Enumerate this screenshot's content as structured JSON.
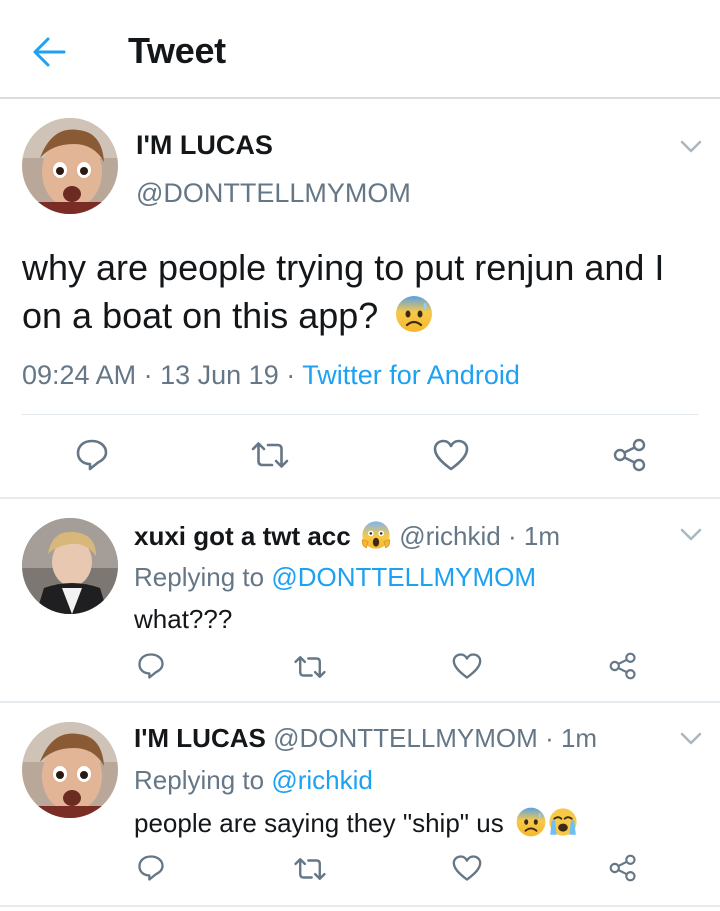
{
  "header": {
    "title": "Tweet"
  },
  "main_tweet": {
    "author_name": "I'M LUCAS",
    "author_handle": "@DONTTELLMYMOM",
    "text": "why are people trying to put renjun and I on a boat on this app?",
    "time": "09:24 AM",
    "date": "13 Jun 19",
    "client": "Twitter for Android",
    "emoji": "anxious-face-with-sweat"
  },
  "replies": [
    {
      "author_name": "xuxi got a twt acc",
      "author_emoji": "face-screaming-in-fear",
      "author_handle": "@richkid",
      "age": "1m",
      "replying_label": "Replying to",
      "replying_to": "@DONTTELLMYMOM",
      "text": "what???"
    },
    {
      "author_name": "I'M LUCAS",
      "author_handle": "@DONTTELLMYMOM",
      "age": "1m",
      "replying_label": "Replying to",
      "replying_to": "@richkid",
      "text": "people are saying they \"ship\" us",
      "emojis": [
        "anxious-face-with-sweat",
        "loudly-crying-face"
      ]
    }
  ],
  "separator": "·",
  "icons": {
    "back": "back-arrow-icon",
    "caret": "chevron-down-icon",
    "reply": "reply-icon",
    "retweet": "retweet-icon",
    "like": "heart-icon",
    "share": "share-icon"
  },
  "colors": {
    "accent": "#1da1f2",
    "secondary_text": "#657786",
    "icon": "#657786",
    "divider": "#e1e8ed"
  }
}
